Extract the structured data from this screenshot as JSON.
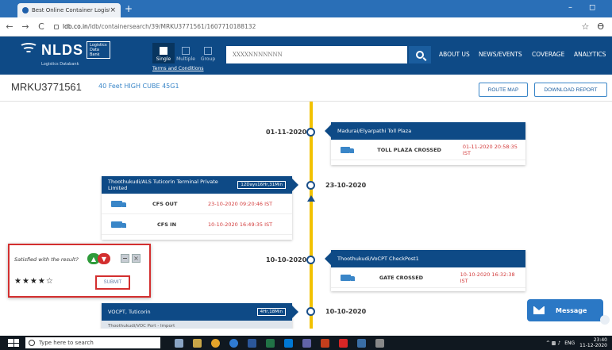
{
  "browser": {
    "tab_title": "Best Online Container Logistics",
    "tab_close": "×",
    "new_tab": "+",
    "back": "←",
    "forward": "→",
    "reload": "C",
    "url_domain": "ldb.co.in",
    "url_path": "/ldb/containersearch/39/MRKU3771561/1607710188132",
    "star": "☆",
    "account": "ϴ",
    "minimize": "–",
    "restore": "◻"
  },
  "header": {
    "logo_text": "NLDS",
    "logo_sub": "Logistics Databank",
    "logo_box": "Logistics Data Bank",
    "modes": [
      {
        "label": "Single"
      },
      {
        "label": "Multiple"
      },
      {
        "label": "Group"
      }
    ],
    "terms": "Terms and Conditions",
    "search_placeholder": "XXXXNNNNNNN",
    "nav": [
      "ABOUT US",
      "NEWS/EVENTS",
      "COVERAGE",
      "ANALYTICS"
    ]
  },
  "container": {
    "number": "MRKU3771561",
    "type": "40 Feet HIGH CUBE 45G1",
    "route_map": "ROUTE MAP",
    "download_report": "DOWNLOAD REPORT"
  },
  "timeline": {
    "dates": [
      "01-11-2020",
      "23-10-2020",
      "10-10-2020",
      "10-10-2020"
    ],
    "cards": [
      {
        "title": "Madurai/Elyarpathi Toll Plaza",
        "events": [
          {
            "name": "TOLL PLAZA CROSSED",
            "time": "01-11-2020 20:58:35 IST"
          }
        ]
      },
      {
        "title": "Thoothukudi/ALS Tuticorin Terminal Private Limited",
        "duration": "12Days16Hr,31Min",
        "events": [
          {
            "name": "CFS OUT",
            "time": "23-10-2020 09:20:46 IST"
          },
          {
            "name": "CFS IN",
            "time": "10-10-2020 16:49:35 IST"
          }
        ]
      },
      {
        "title": "Thoothukudi/VoCPT CheckPost1",
        "events": [
          {
            "name": "GATE CROSSED",
            "time": "10-10-2020 16:32:38 IST"
          }
        ]
      },
      {
        "title": "VOCPT, Tuticorin",
        "duration": "4Hr,18Min",
        "events": [
          {
            "name": "Thoothukudi/VOC Port - Import",
            "time": ""
          }
        ]
      }
    ]
  },
  "feedback": {
    "question": "Satisfied with the result?",
    "close": "×",
    "stars": "★★★★☆",
    "submit": "SUBMIT",
    "rating": 4
  },
  "message_button": "Message",
  "taskbar": {
    "search_placeholder": "Type here to search",
    "tray_lang": "ENG",
    "time": "23:40",
    "date": "11-12-2020"
  },
  "colors": {
    "brand_blue": "#0e4a86",
    "timeline_yellow": "#f2c200",
    "time_red": "#d23a3a",
    "highlight_red": "#d32f2f"
  }
}
